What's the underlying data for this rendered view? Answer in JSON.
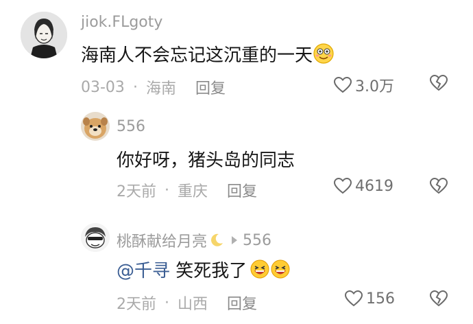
{
  "comments": [
    {
      "username": "jiok.FLgoty",
      "text": "海南人不会忘记这沉重的一天",
      "emoji": "smiling-face-emoji",
      "date": "03-03",
      "location": "海南",
      "reply_label": "回复",
      "likes": "3.0万"
    },
    {
      "username": "556",
      "text": "你好呀，猪头岛的同志",
      "date": "2天前",
      "location": "重庆",
      "reply_label": "回复",
      "likes": "4619"
    },
    {
      "username": "桃酥献给月亮",
      "reply_to": "556",
      "mention": "@千寻",
      "text": " 笑死我了",
      "emoji": "laughing-face-emoji",
      "date": "2天前",
      "location": "山西",
      "reply_label": "回复",
      "likes": "156"
    }
  ],
  "colors": {
    "text": "#161616",
    "meta": "#a9a9a9",
    "mention": "#3a5d93",
    "background": "#ffffff"
  },
  "separator": "·"
}
